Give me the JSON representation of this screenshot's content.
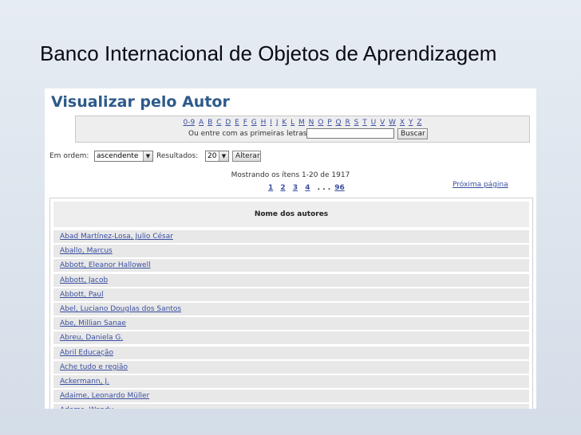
{
  "slide_title": "Banco Internacional de Objetos de Aprendizagem",
  "page_heading": "Visualizar pelo Autor",
  "alphabet": [
    "0-9",
    "A",
    "B",
    "C",
    "D",
    "E",
    "F",
    "G",
    "H",
    "I",
    "J",
    "K",
    "L",
    "M",
    "N",
    "O",
    "P",
    "Q",
    "R",
    "S",
    "T",
    "U",
    "V",
    "W",
    "X",
    "Y",
    "Z"
  ],
  "first_letters_label": "Ou entre com as primeiras letras:",
  "first_letters_value": "",
  "search_button": "Buscar",
  "order_label": "Em ordem:",
  "order_value": "ascendente",
  "results_label": "Resultados:",
  "results_value": "20",
  "alter_button": "Alterar",
  "showing_text": "Mostrando os ítens 1-20 de 1917",
  "pager": {
    "pages": [
      "1",
      "2",
      "3",
      "4"
    ],
    "ellipsis": ". . .",
    "last": "96"
  },
  "next_page": "Próxima página",
  "table_header": "Nome dos autores",
  "authors": [
    "Abad Martínez-Losa, Julio César",
    "Aballo, Marcus",
    "Abbott, Eleanor Hallowell",
    "Abbott, Jacob",
    "Abbott, Paul",
    "Abel, Luciano Douglas dos Santos",
    "Abe, Millian Sanae",
    "Abreu, Daniela G.",
    "Abril Educação",
    "Ache tudo e região",
    "Ackermann, J.",
    "Adaime, Leonardo Müller",
    "Adams, Wendy"
  ]
}
